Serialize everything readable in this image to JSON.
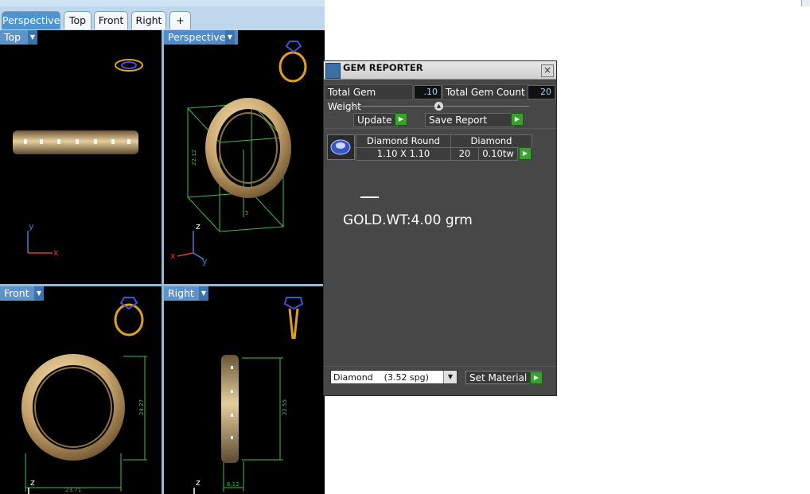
{
  "tabs": [
    {
      "label": "Perspective",
      "active": true
    },
    {
      "label": "Top",
      "active": false
    },
    {
      "label": "Front",
      "active": false
    },
    {
      "label": "Right",
      "active": false
    },
    {
      "label": "+",
      "active": false
    }
  ],
  "viewports": {
    "top": {
      "label": "Top"
    },
    "perspective": {
      "label": "Perspective"
    },
    "front": {
      "label": "Front"
    },
    "right": {
      "label": "Right"
    }
  },
  "axes": {
    "x": "x",
    "y": "y",
    "z": "z"
  },
  "dimensions": {
    "perspective_height": "22.12",
    "perspective_width": "5",
    "front_height": "24.27",
    "front_width": "23.71",
    "right_height": "22.55",
    "right_width": "6.12"
  },
  "gem_reporter": {
    "title": "GEM REPORTER",
    "close_label": "×",
    "total_gem_weight_label": "Total Gem Weight",
    "total_gem_weight_value": ".10",
    "total_gem_count_label": "Total Gem Count",
    "total_gem_count_value": "20",
    "update_label": "Update",
    "save_report_label": "Save Report",
    "table": {
      "headers": [
        "Diamond Round",
        "Diamond"
      ],
      "size": "1.10 X 1.10",
      "count": "20",
      "weight": "0.10tw"
    },
    "note": "GOLD.WT:4.00 grm",
    "material_select": "Diamond    (3.52 spg)",
    "set_material_label": "Set Material"
  },
  "colors": {
    "tab_active": "#4d94d0",
    "viewport_bg": "#000000",
    "panel_bg": "#474747",
    "gold": "#c9a46a",
    "dimension_green": "#3fbf3f"
  }
}
